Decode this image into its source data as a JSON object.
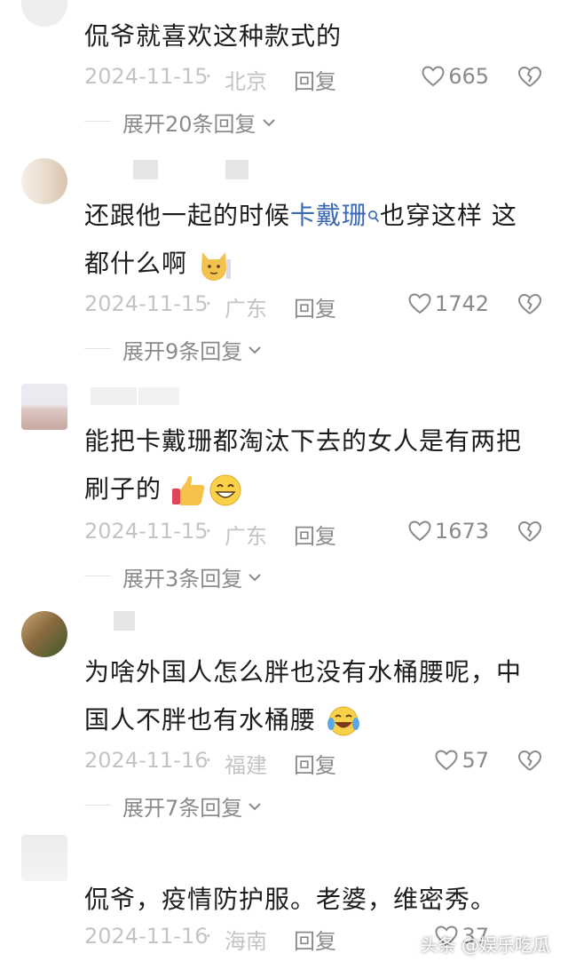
{
  "comments": [
    {
      "text": "侃爷就喜欢这种款式的",
      "date": "2024-11-15",
      "sep": "·",
      "location": "北京",
      "reply": "回复",
      "likes": "665",
      "expand": "展开20条回复"
    },
    {
      "text_a": "还跟他一起的时候",
      "link": "卡戴珊",
      "text_b": "也穿这样 这",
      "text_c": "都什么啊",
      "date": "2024-11-15",
      "sep": "·",
      "location": "广东",
      "reply": "回复",
      "likes": "1742",
      "expand": "展开9条回复"
    },
    {
      "text_a": "能把卡戴珊都淘汰下去的女人是有两把",
      "text_b": "刷子的",
      "date": "2024-11-15",
      "sep": "·",
      "location": "广东",
      "reply": "回复",
      "likes": "1673",
      "expand": "展开3条回复"
    },
    {
      "text_a": "为啥外国人怎么胖也没有水桶腰呢，中",
      "text_b": "国人不胖也有水桶腰",
      "date": "2024-11-16",
      "sep": "·",
      "location": "福建",
      "reply": "回复",
      "likes": "57",
      "expand": "展开7条回复"
    },
    {
      "text": "侃爷，疫情防护服。老婆，维密秀。",
      "date": "2024-11-16",
      "sep": "·",
      "location": "海南",
      "reply": "回复",
      "likes": "37"
    }
  ],
  "watermark": "头条 @娱乐吃瓜",
  "icons": {
    "like": "heart-outline-icon",
    "dislike": "broken-heart-icon",
    "expand": "chevron-down-icon",
    "search": "search-icon"
  },
  "colors": {
    "link": "#3a69b8",
    "meta": "#c4c4c4",
    "action": "#8a8a8a"
  }
}
